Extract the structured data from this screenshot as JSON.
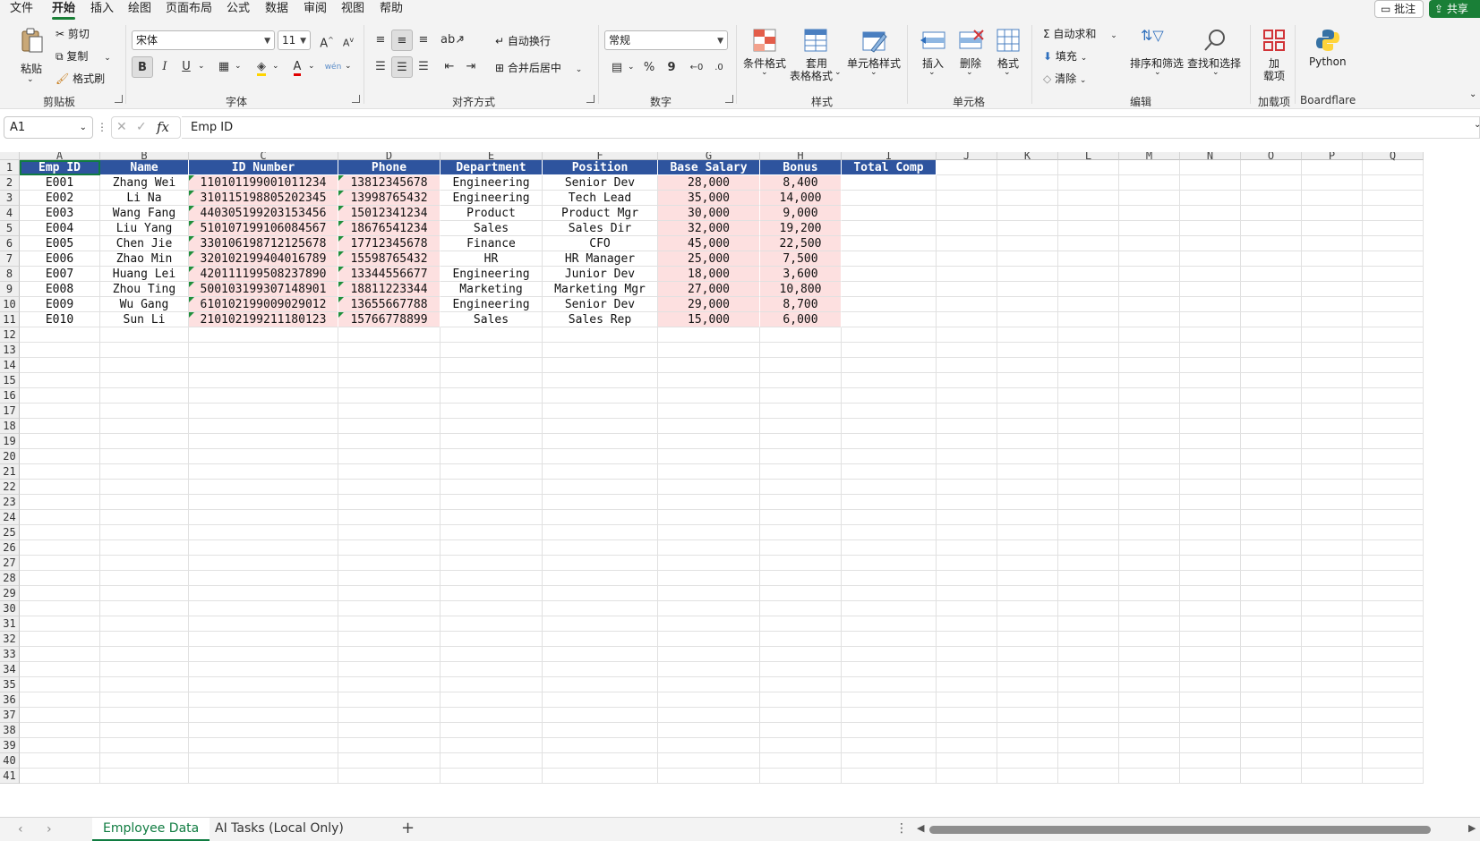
{
  "menu": {
    "tabs": [
      "文件",
      "开始",
      "插入",
      "绘图",
      "页面布局",
      "公式",
      "数据",
      "审阅",
      "视图",
      "帮助"
    ],
    "active": "开始",
    "comment": "批注",
    "share": "共享"
  },
  "ribbon": {
    "clipboard": {
      "paste": "粘贴",
      "cut": "剪切",
      "copy": "复制",
      "format_painter": "格式刷",
      "group": "剪贴板"
    },
    "font": {
      "name": "宋体",
      "size": "11",
      "group": "字体",
      "grow": "A",
      "shrink": "A",
      "bold": "B",
      "italic": "I",
      "underline": "U",
      "pinyin": "wén"
    },
    "alignment": {
      "wrap": "自动换行",
      "merge": "合并后居中",
      "group": "对齐方式"
    },
    "number": {
      "format": "常规",
      "group": "数字",
      "percent": "%",
      "comma": "9"
    },
    "styles": {
      "conditional": "条件格式",
      "table_top": "套用",
      "table_bottom": "表格格式",
      "cell_styles": "单元格样式",
      "group": "样式"
    },
    "cells": {
      "insert": "插入",
      "delete": "删除",
      "format": "格式",
      "group": "单元格"
    },
    "editing": {
      "autosum": "自动求和",
      "fill": "填充",
      "clear": "清除",
      "sort": "排序和筛选",
      "find": "查找和选择",
      "group": "编辑"
    },
    "addins": {
      "top": "加",
      "bottom": "载项",
      "group": "加载项"
    },
    "python": {
      "label": "Python",
      "group": "Boardflare"
    }
  },
  "formula_bar": {
    "name_box": "A1",
    "fx": "fx",
    "content": "Emp ID"
  },
  "grid": {
    "columns": [
      "A",
      "B",
      "C",
      "D",
      "E",
      "F",
      "G",
      "H",
      "I",
      "J",
      "K",
      "L",
      "M",
      "N",
      "O",
      "P",
      "Q"
    ],
    "header_row": [
      "Emp ID",
      "Name",
      "ID Number",
      "Phone",
      "Department",
      "Position",
      "Base Salary",
      "Bonus",
      "Total Comp"
    ],
    "rows": [
      [
        "E001",
        "Zhang Wei",
        "110101199001011234",
        "13812345678",
        "Engineering",
        "Senior Dev",
        "28,000",
        "8,400"
      ],
      [
        "E002",
        "Li Na",
        "310115198805202345",
        "13998765432",
        "Engineering",
        "Tech Lead",
        "35,000",
        "14,000"
      ],
      [
        "E003",
        "Wang Fang",
        "440305199203153456",
        "15012341234",
        "Product",
        "Product Mgr",
        "30,000",
        "9,000"
      ],
      [
        "E004",
        "Liu Yang",
        "510107199106084567",
        "18676541234",
        "Sales",
        "Sales Dir",
        "32,000",
        "19,200"
      ],
      [
        "E005",
        "Chen Jie",
        "330106198712125678",
        "17712345678",
        "Finance",
        "CFO",
        "45,000",
        "22,500"
      ],
      [
        "E006",
        "Zhao Min",
        "320102199404016789",
        "15598765432",
        "HR",
        "HR Manager",
        "25,000",
        "7,500"
      ],
      [
        "E007",
        "Huang Lei",
        "420111199508237890",
        "13344556677",
        "Engineering",
        "Junior Dev",
        "18,000",
        "3,600"
      ],
      [
        "E008",
        "Zhou Ting",
        "500103199307148901",
        "18811223344",
        "Marketing",
        "Marketing Mgr",
        "27,000",
        "10,800"
      ],
      [
        "E009",
        "Wu Gang",
        "610102199009029012",
        "13655667788",
        "Engineering",
        "Senior Dev",
        "29,000",
        "8,700"
      ],
      [
        "E010",
        "Sun Li",
        "210102199211180123",
        "15766778899",
        "Sales",
        "Sales Rep",
        "15,000",
        "6,000"
      ]
    ],
    "row_numbers": [
      "1",
      "2",
      "3",
      "4",
      "5",
      "6",
      "7",
      "8",
      "9",
      "10",
      "11",
      "12",
      "13",
      "14",
      "15",
      "16",
      "17",
      "18",
      "19",
      "20",
      "21",
      "22",
      "23",
      "24",
      "25",
      "26",
      "27",
      "28",
      "29",
      "30",
      "31",
      "32",
      "33",
      "34",
      "35",
      "36",
      "37",
      "38",
      "39",
      "40",
      "41"
    ],
    "colors": {
      "header_bg": "#2e549e",
      "header_fg": "#ffffff",
      "highlight_bg": "#fde0e0",
      "accent": "#107c41"
    }
  },
  "sheets": {
    "tabs": [
      "Employee Data",
      "AI Tasks (Local Only)"
    ],
    "active": "Employee Data",
    "add": "+"
  }
}
